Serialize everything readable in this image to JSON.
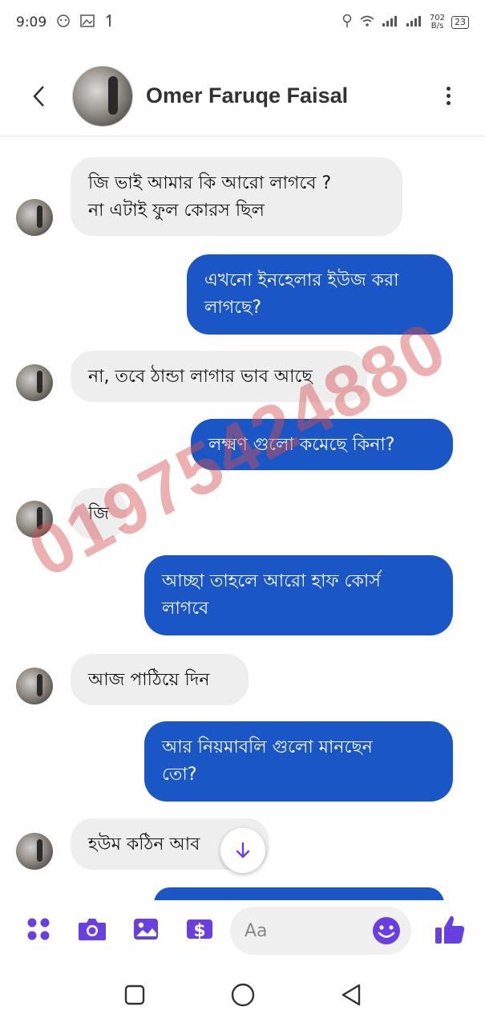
{
  "status_bar": {
    "time": "9:09",
    "left_icons": [
      "face-icon",
      "image-icon",
      "one-icon"
    ],
    "net_speed_value": "702",
    "net_speed_unit": "B/s",
    "battery": "23"
  },
  "header": {
    "contact_name": "Omer Faruqe Faisal"
  },
  "messages": [
    {
      "direction": "in",
      "text_line1": "জি ভাই আমার কি আরো লাগবে ?",
      "text_line2": "না এটাই ফুল কোরস ছিল"
    },
    {
      "direction": "out",
      "text_line1": "এখনো ইনহেলার ইউজ করা",
      "text_line2": "লাগছে?"
    },
    {
      "direction": "in",
      "text_line1": "না, তবে ঠান্ডা লাগার ভাব আছে"
    },
    {
      "direction": "out",
      "text_line1": "লক্ষ্মণ গুলো কমেছে কিনা?"
    },
    {
      "direction": "in",
      "text_line1": "জি"
    },
    {
      "direction": "out",
      "text_line1": "আচ্ছা তাহলে আরো হাফ কোর্স",
      "text_line2": "লাগবে"
    },
    {
      "direction": "in",
      "text_line1": "আজ পাঠিয়ে দিন"
    },
    {
      "direction": "out",
      "text_line1": "আর নিয়মাবলি গুলো মানছেন",
      "text_line2": "তো?"
    },
    {
      "direction": "in",
      "text_line1": "হউম কঠিন আব"
    }
  ],
  "watermark": "01975424880",
  "composer": {
    "placeholder": "Aa"
  },
  "colors": {
    "accent": "#6a3fe0",
    "outgoing_bubble": "#1a56c5",
    "incoming_bubble": "#eeeeee"
  }
}
